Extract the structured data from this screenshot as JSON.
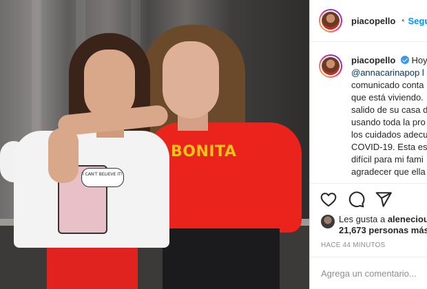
{
  "post": {
    "username": "piacopello",
    "follow_label": "Seguir",
    "shirt_text": "BONITA",
    "shirt_bubble": "I CAN'T BELIEVE IT!"
  },
  "caption": {
    "username": "piacopello",
    "lines": [
      "Hoy",
      "@annacarinapop l",
      "comunicado conta",
      "que está viviendo.",
      "salido de su casa d",
      "usando toda la pro",
      "los cuidados adecu",
      "COVID-19. Esta es",
      "difícil para mi fami",
      "agradecer que ella"
    ]
  },
  "actions": {
    "like_icon": "heart-icon",
    "comment_icon": "comment-icon",
    "share_icon": "paper-plane-icon"
  },
  "likes": {
    "prefix": "Les gusta a ",
    "user": "alenecious",
    "count_line": "21,673 personas más"
  },
  "timestamp": "HACE 44 MINUTOS",
  "comment_box": {
    "placeholder": "Agrega un comentario..."
  },
  "colors": {
    "accent": "#0095f6",
    "verified": "#3897f0",
    "shirt_red": "#ea231c",
    "shirt_text": "#f3c316"
  }
}
